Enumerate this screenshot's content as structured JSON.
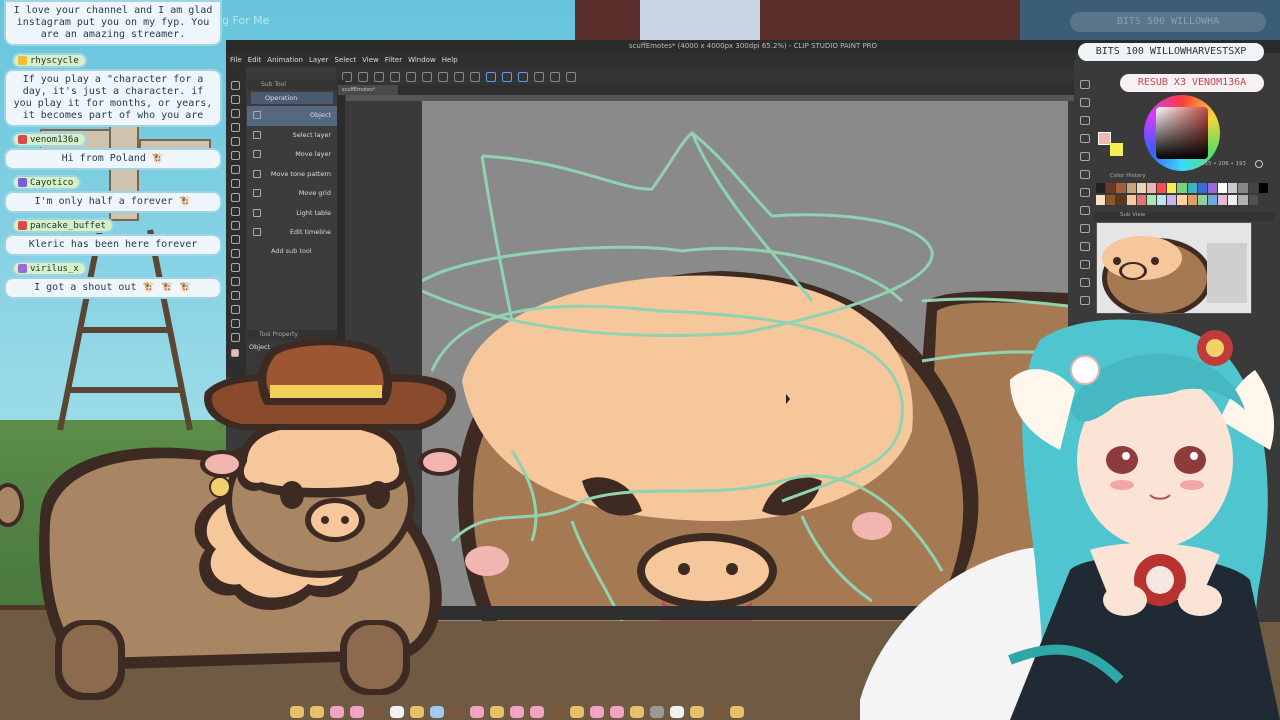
{
  "chat": {
    "top_message": "I love your channel and I am glad instagram put you on my fyp. You are an amazing streamer.",
    "ghost_text": "g For Me",
    "messages": [
      {
        "user": "rhyscycle",
        "badge_color": "#f0c030",
        "text": "If you play a \"character for a day, it's just a character. if you play it for months, or years, it becomes part of who you are"
      },
      {
        "user": "venom136a",
        "badge_color": "#d94a4a",
        "text": "Hi from Poland 🐮"
      },
      {
        "user": "Cayotico",
        "badge_color": "#7a5de0",
        "text": "I'm only half a forever 🐮"
      },
      {
        "user": "pancake_buffet",
        "badge_color": "#d94a4a",
        "text": "Kleric has been here forever"
      },
      {
        "user": "virilus_x",
        "badge_color": "#9c6ad6",
        "text": "I got a shout out 🐮 🐮 🐮"
      }
    ]
  },
  "alerts": {
    "bits_faded": "BITS 500 WILLOWHA",
    "bits": "BITS 100 WILLOWHARVESTSXP",
    "resub": "RESUB X3 VENOM136A"
  },
  "app": {
    "title": "scuffEmotes* (4000 x 4000px 300dpi 65.2%) - CLIP STUDIO PAINT PRO",
    "menu": [
      "File",
      "Edit",
      "Animation",
      "Layer",
      "Select",
      "View",
      "Filter",
      "Window",
      "Help"
    ],
    "canvas_tab": "scuffEmotes*",
    "subtool": {
      "header": "Sub Tool",
      "group": "Operation",
      "items": [
        "Object",
        "Select layer",
        "Move layer",
        "Move tone pattern",
        "Move grid",
        "Light table",
        "Edit timeline"
      ],
      "add_label": "Add sub tool"
    },
    "tool_property": {
      "header": "Tool Property",
      "label": "Object"
    },
    "color": {
      "readout": "255 • 206 • 193",
      "history_label": "Color History",
      "subview_label": "Sub View",
      "main_color": "#f2b6b1",
      "sub_color": "#f5f051",
      "history": [
        "#222222",
        "#6b3b2a",
        "#a0603a",
        "#c8a478",
        "#e9d7b2",
        "#f2b6b1",
        "#ff4b4b",
        "#f5f051",
        "#7ad37a",
        "#3bb3c3",
        "#3b6bd3",
        "#9a6ad6",
        "#ffffff",
        "#cccccc",
        "#888888",
        "#444444",
        "#000000",
        "#f6e3c7",
        "#8b5a2b",
        "#5b3a1a",
        "#f7c9a0",
        "#e57373",
        "#aee7ae",
        "#b5e6f3",
        "#c7b3f0",
        "#ffd39b",
        "#d9a066",
        "#8fd19e",
        "#6fa8dc",
        "#e6b8d0",
        "#f0f0f0",
        "#b0b0b0",
        "#505050"
      ]
    }
  },
  "colors": {
    "chat_bg": "#eef6fb",
    "chat_border": "#9fd3e6",
    "resub_text": "#c8434f",
    "canvas_bg": "#8a8a8a",
    "outline_mint": "#8fd3b0",
    "bull_brown": "#8b6a4e",
    "bull_skin": "#f7c79c"
  }
}
